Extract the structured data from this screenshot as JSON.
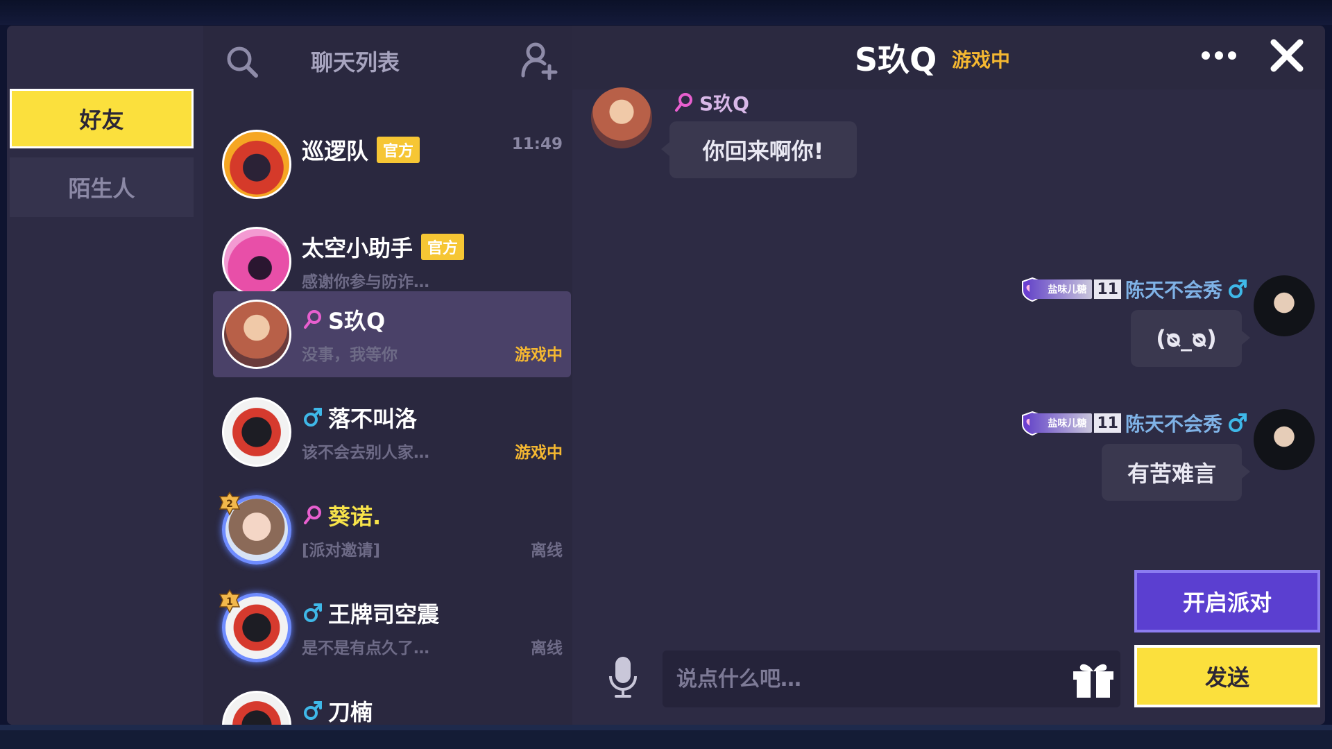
{
  "categories": {
    "friends": "好友",
    "strangers": "陌生人"
  },
  "list": {
    "title": "聊天列表",
    "items": [
      {
        "name": "巡逻队",
        "badge": "官方",
        "time": "11:49",
        "preview": "",
        "status": ""
      },
      {
        "name": "太空小助手",
        "badge": "官方",
        "time": "",
        "preview": "感谢你参与防诈…",
        "status": ""
      },
      {
        "name": "S玖Q",
        "badge": "",
        "time": "",
        "preview": "没事，我等你",
        "status": "游戏中"
      },
      {
        "name": "落不叫洛",
        "badge": "",
        "time": "",
        "preview": "该不会去别人家…",
        "status": "游戏中"
      },
      {
        "name": "葵诺.",
        "badge": "",
        "time": "",
        "preview": "[派对邀请]",
        "status": "离线",
        "rank": "2"
      },
      {
        "name": "王牌司空震",
        "badge": "",
        "time": "",
        "preview": "是不是有点久了…",
        "status": "离线",
        "rank": "1"
      },
      {
        "name": "刀楠",
        "badge": "",
        "time": "",
        "preview": "",
        "status": ""
      }
    ]
  },
  "chat": {
    "title": "S玖Q",
    "status": "游戏中",
    "messages": [
      {
        "sender": "S玖Q",
        "text": "你回来啊你!",
        "side": "left"
      },
      {
        "sender": "陈天不会秀",
        "tag": "盐味儿糖",
        "level": "11",
        "text": "(ᴓ_ᴓ)",
        "side": "right"
      },
      {
        "sender": "陈天不会秀",
        "tag": "盐味儿糖",
        "level": "11",
        "text": "有苦难言",
        "side": "right"
      }
    ],
    "input_placeholder": "说点什么吧…",
    "party_button": "开启派对",
    "send_button": "发送"
  },
  "colors": {
    "accent_yellow": "#fbe03d",
    "accent_purple": "#5b3fd0",
    "status_ingame": "#f5b831",
    "female_pink": "#e85fcf",
    "male_blue": "#3fb8e8"
  },
  "icons": [
    "search-icon",
    "add-friend-icon",
    "more-icon",
    "close-icon",
    "mic-icon",
    "gift-icon",
    "female-icon",
    "male-icon"
  ]
}
